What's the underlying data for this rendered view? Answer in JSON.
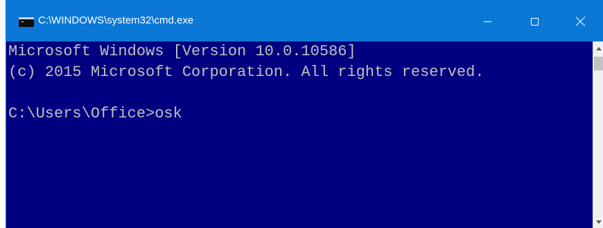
{
  "window": {
    "title": "C:\\WINDOWS\\system32\\cmd.exe",
    "icon": "console-icon"
  },
  "window_controls": {
    "minimize_icon": "minimize-icon",
    "maximize_icon": "maximize-icon",
    "close_icon": "close-icon"
  },
  "console": {
    "lines": [
      "Microsoft Windows [Version 10.0.10586]",
      "(c) 2015 Microsoft Corporation. All rights reserved.",
      "",
      "C:\\Users\\Office>osk"
    ],
    "colors": {
      "background": "#000080",
      "text": "#c0c0c0",
      "titlebar": "#0b78d7"
    }
  },
  "scrollbar": {
    "up_icon": "scroll-up-arrow-icon",
    "down_icon": "scroll-down-arrow-icon"
  }
}
